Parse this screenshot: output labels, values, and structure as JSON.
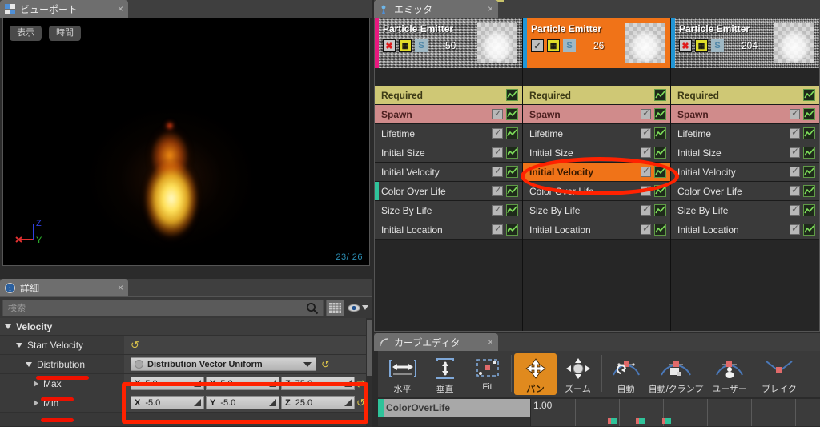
{
  "viewport": {
    "tab_label": "ビューポート",
    "tab_icon": "viewport-icon",
    "close_icon": "×",
    "buttons": [
      {
        "name": "show-button",
        "label": "表示"
      },
      {
        "name": "time-button",
        "label": "時間"
      }
    ],
    "gizmo": {
      "x_label": "X",
      "y_label": "Y",
      "z_label": "Z",
      "x_color": "#e03030",
      "y_color": "#30c030",
      "z_color": "#3040e0"
    },
    "counter": "23/ 26",
    "counter_color": "#2c8fb5",
    "background": "#000000"
  },
  "details": {
    "tab_label": "詳細",
    "tab_icon": "info-icon",
    "close_icon": "×",
    "search": {
      "placeholder": "検索",
      "value": "",
      "icon": "search-icon"
    },
    "toolbar_icons": [
      "grid-icon",
      "eye-icon",
      "chevron-down-icon"
    ],
    "category": {
      "label": "Velocity",
      "expanded": true
    },
    "properties": [
      {
        "label": "Start Velocity",
        "indent": 1,
        "expanded": true,
        "type": "group",
        "reset": "↺"
      },
      {
        "label": "Distribution",
        "indent": 2,
        "expanded": true,
        "type": "select",
        "value": "Distribution Vector Uniform",
        "reset": "↺"
      },
      {
        "label": "Max",
        "indent": 3,
        "expanded": false,
        "type": "vector",
        "reset": "⇄",
        "axes": [
          {
            "axis": "X",
            "value": "5.0"
          },
          {
            "axis": "Y",
            "value": "5.0"
          },
          {
            "axis": "Z",
            "value": "75.0"
          }
        ]
      },
      {
        "label": "Min",
        "indent": 3,
        "expanded": false,
        "type": "vector",
        "reset": "↺",
        "axes": [
          {
            "axis": "X",
            "value": "-5.0"
          },
          {
            "axis": "Y",
            "value": "-5.0"
          },
          {
            "axis": "Z",
            "value": "25.0"
          }
        ]
      }
    ]
  },
  "emitters": {
    "tab_label": "エミッタ",
    "tab_icon": "emitter-icon",
    "close_icon": "×",
    "columns": [
      {
        "name": "Particle Emitter",
        "count": "50",
        "selected": false,
        "bar_color": "#e8197f",
        "enabled_icon": "x-icon",
        "solo_label": "S"
      },
      {
        "name": "Particle Emitter",
        "count": "26",
        "selected": true,
        "bar_color": "#2196d6",
        "enabled_icon": "check-icon",
        "solo_label": "S"
      },
      {
        "name": "Particle Emitter",
        "count": "204",
        "selected": false,
        "bar_color": "#2196d6",
        "enabled_icon": "x-icon",
        "solo_label": "S"
      }
    ],
    "modules": [
      {
        "label": "Required",
        "style": "required",
        "checkbox": false,
        "graph": true,
        "bar": null
      },
      {
        "label": "Spawn",
        "style": "spawn",
        "checkbox": true,
        "graph": true,
        "bar": null
      },
      {
        "label": "Lifetime",
        "style": "normal",
        "checkbox": true,
        "graph": true,
        "bar": null
      },
      {
        "label": "Initial Size",
        "style": "normal",
        "checkbox": true,
        "graph": true,
        "bar": null
      },
      {
        "label": "Initial Velocity",
        "style": "normal",
        "checkbox": true,
        "graph": true,
        "bar": null
      },
      {
        "label": "Color Over Life",
        "style": "normal",
        "checkbox": true,
        "graph": true,
        "bar": "#2fc39a"
      },
      {
        "label": "Size By Life",
        "style": "normal",
        "checkbox": true,
        "graph": true,
        "bar": null
      },
      {
        "label": "Initial Location",
        "style": "normal",
        "checkbox": true,
        "graph": true,
        "bar": null
      }
    ],
    "selected_module_index": 4,
    "selected_column_index": 1,
    "selected_color": "#f07318"
  },
  "curve_editor": {
    "tab_label": "カーブエディタ",
    "tab_icon": "curve-icon",
    "close_icon": "×",
    "tools": [
      {
        "name": "fit-horizontal-button",
        "label": "水平",
        "icon": "fit-horizontal-icon",
        "active": false
      },
      {
        "name": "fit-vertical-button",
        "label": "垂直",
        "icon": "fit-vertical-icon",
        "active": false
      },
      {
        "name": "fit-button",
        "label": "Fit",
        "icon": "fit-icon",
        "active": false
      },
      {
        "name": "pan-button",
        "label": "パン",
        "icon": "pan-icon",
        "active": true
      },
      {
        "name": "zoom-button",
        "label": "ズーム",
        "icon": "zoom-icon",
        "active": false
      },
      {
        "name": "auto-button",
        "label": "自動",
        "icon": "auto-tangent-icon",
        "active": false
      },
      {
        "name": "auto-clamped-button",
        "label": "自動/クランプ",
        "icon": "auto-clamped-icon",
        "active": false
      },
      {
        "name": "user-button",
        "label": "ユーザー",
        "icon": "user-tangent-icon",
        "active": false
      },
      {
        "name": "break-button",
        "label": "ブレイク",
        "icon": "break-tangent-icon",
        "active": false
      }
    ],
    "track": {
      "label": "ColorOverLife",
      "bar_color": "#2fc39a",
      "value": "1.00"
    }
  },
  "annotations": {
    "color": "#ff2200",
    "shapes": [
      "oval-around-initial-velocity",
      "rect-around-velocity-values",
      "underline-distribution",
      "underline-max",
      "underline-min"
    ]
  }
}
